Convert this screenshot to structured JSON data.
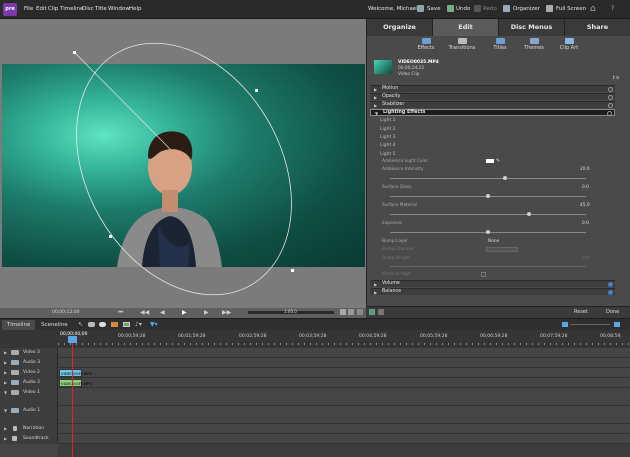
{
  "app": {
    "logo": "pre"
  },
  "menus": [
    "File",
    "Edit",
    "Clip",
    "Timeline",
    "Disc",
    "Title",
    "Window",
    "Help"
  ],
  "topbar": {
    "welcome": "Welcome, Michael",
    "save": "Save",
    "undo": "Undo",
    "redo": "Redo",
    "organizer": "Organizer",
    "fullscreen": "Full Screen"
  },
  "monitor": {
    "timecode": "00;00;12;00",
    "duration": "1:00:25",
    "scale_label": "1:00.0"
  },
  "panel": {
    "tabs": [
      "Organize",
      "Edit",
      "Disc Menus",
      "Share"
    ],
    "active_tab": "Edit",
    "subtabs": [
      "Effects",
      "Transitions",
      "Titles",
      "Themes",
      "Clip Art"
    ],
    "clip": {
      "name": "VIDEO0035.MP4",
      "duration": "00;00;24;22",
      "type": "Video Clip"
    },
    "effects": [
      {
        "name": "Motion"
      },
      {
        "name": "Opacity"
      },
      {
        "name": "Stabilizer"
      },
      {
        "name": "Lighting Effects"
      }
    ],
    "lights": [
      "Light 1",
      "Light 2",
      "Light 3",
      "Light 4",
      "Light 5"
    ],
    "props": {
      "ambient_color": "Ambience Light Color",
      "ambient_intensity": "Ambience Intensity",
      "ambient_intensity_val": "20.0",
      "surface_gloss": "Surface Gloss",
      "surface_gloss_val": "0.0",
      "surface_material": "Surface Material",
      "surface_material_val": "45.0",
      "exposure": "Exposure",
      "exposure_val": "0.0",
      "bump_layer": "Bump Layer",
      "bump_layer_val": "None",
      "bump_channel": "Bump Channel",
      "bump_height": "Bump Height",
      "bump_height_val": "0.0",
      "white_is_high": "White Is High"
    },
    "bottom_effects": [
      {
        "name": "Volume"
      },
      {
        "name": "Balance"
      }
    ],
    "reset": "Reset",
    "done": "Done"
  },
  "timeline": {
    "tabs": [
      "Timeline",
      "Sceneline"
    ],
    "current_time": "00;00;00;00",
    "ruler": [
      "00;00;00;00",
      "00;00;59;28",
      "00;01;59;28",
      "00;02;59;28",
      "00;03;59;28",
      "00;04;59;28",
      "00;05;59;28",
      "00;06;59;28",
      "00;07;59;28",
      "00;08;59;"
    ],
    "tracks": [
      {
        "name": "Video 3",
        "kind": "video"
      },
      {
        "name": "Audio 3",
        "kind": "audio"
      },
      {
        "name": "Video 2",
        "kind": "video",
        "clip": "VIDEO0035.MP4"
      },
      {
        "name": "Audio 2",
        "kind": "audio",
        "clip": "VIDEO0035.MP4"
      },
      {
        "name": "Video 1",
        "kind": "video"
      },
      {
        "name": "Audio 1",
        "kind": "audio"
      },
      {
        "name": "Narration",
        "kind": "narration"
      },
      {
        "name": "Soundtrack",
        "kind": "soundtrack"
      }
    ]
  },
  "colors": {
    "video_clip": "#6fc4e8",
    "audio_clip": "#8ed27a",
    "accent": "#5aa7e6",
    "playhead": "#dd2233"
  }
}
